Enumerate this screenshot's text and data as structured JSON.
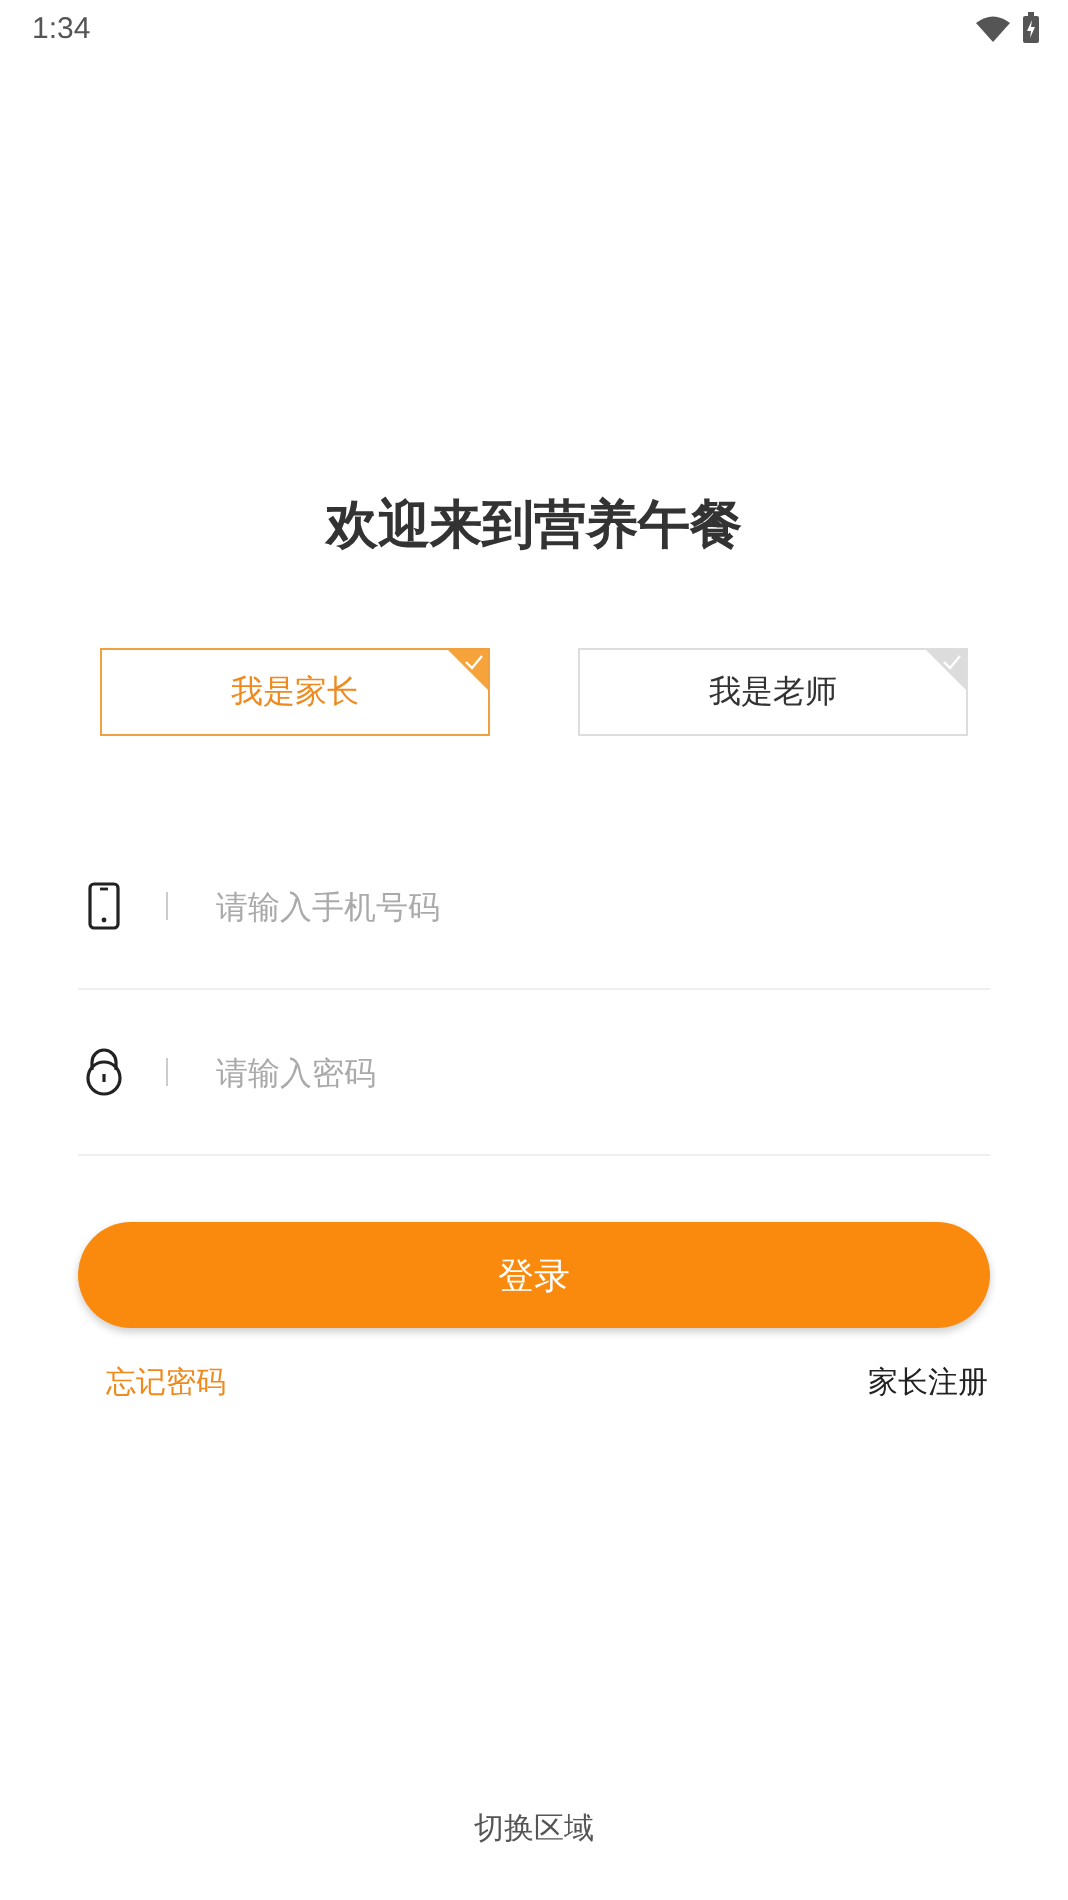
{
  "status_bar": {
    "time": "1:34"
  },
  "title": "欢迎来到营养午餐",
  "roles": [
    {
      "label": "我是家长",
      "selected": true
    },
    {
      "label": "我是老师",
      "selected": false
    }
  ],
  "fields": [
    {
      "kind": "phone",
      "placeholder": "请输入手机号码"
    },
    {
      "kind": "password",
      "placeholder": "请输入密码"
    }
  ],
  "login_button": "登录",
  "forgot_link": "忘记密码",
  "register_link": "家长注册",
  "switch_region": "切换区域"
}
